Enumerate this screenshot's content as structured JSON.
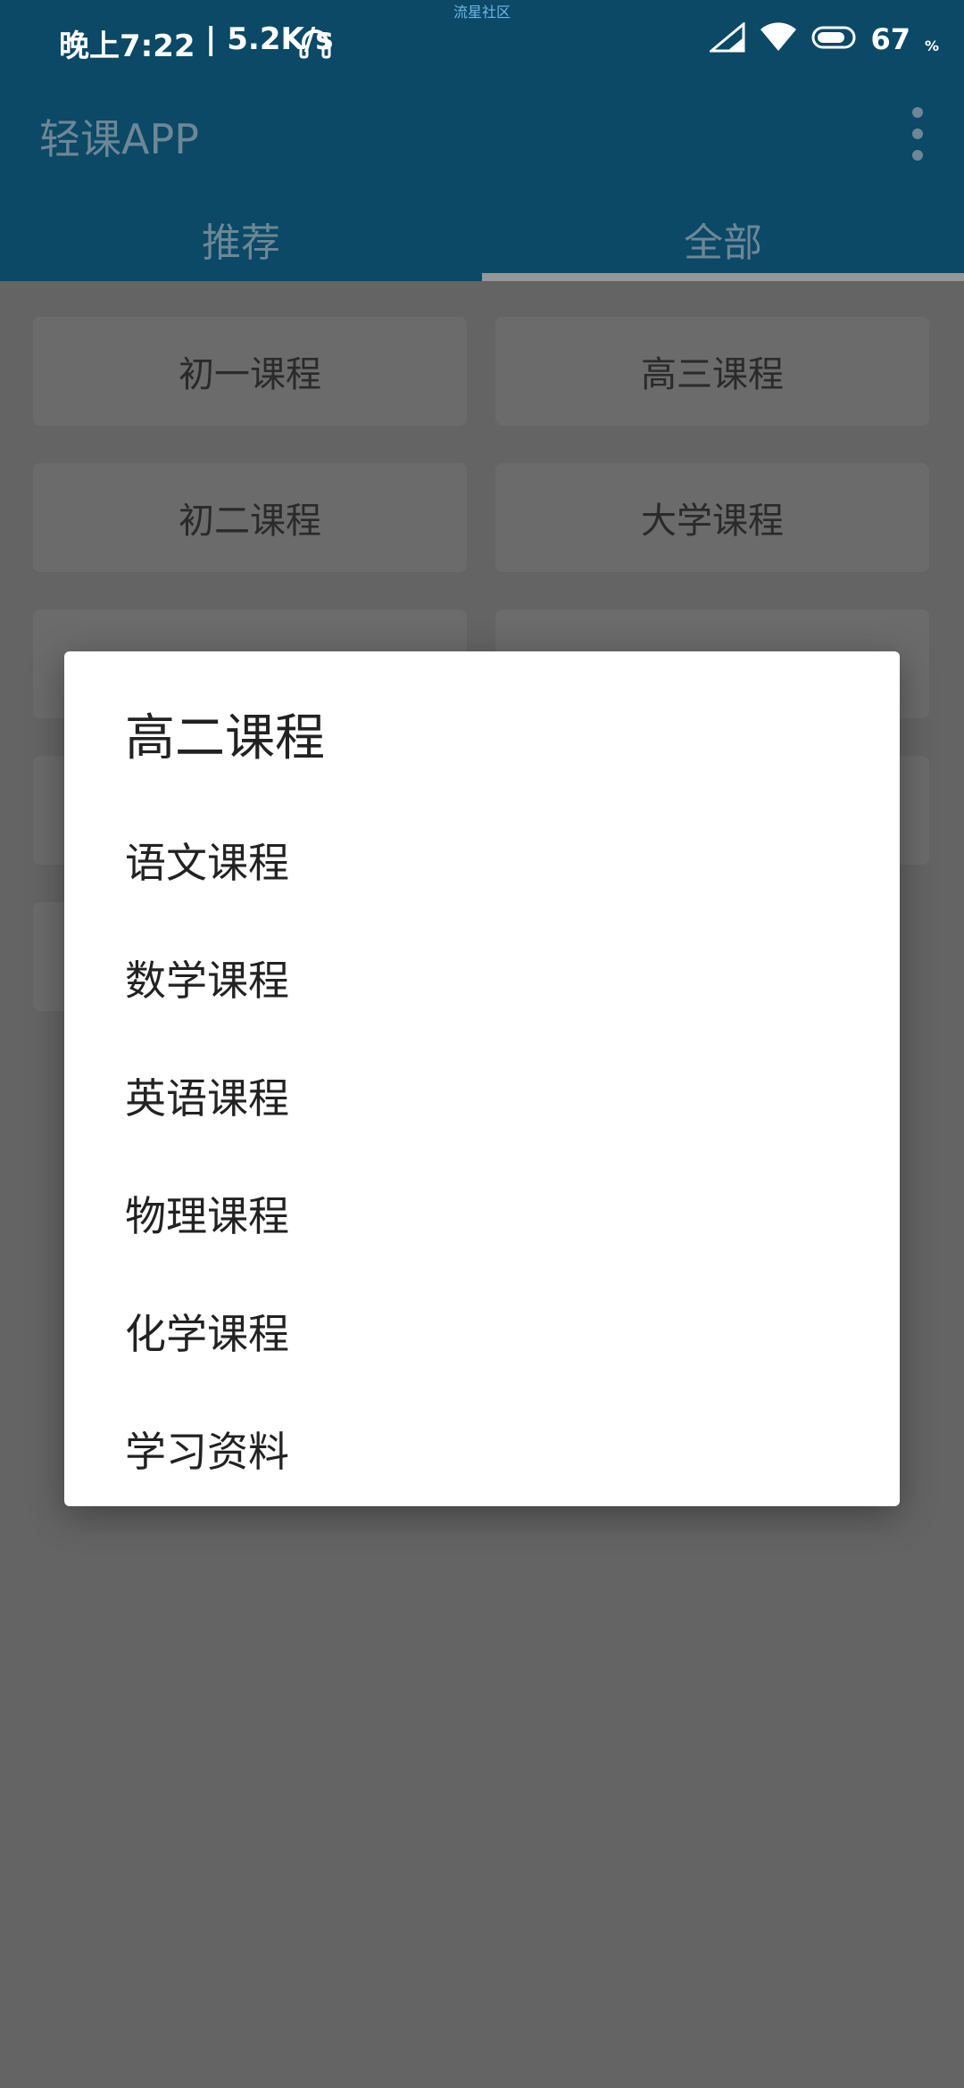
{
  "status_bar": {
    "time": "晚上7:22",
    "network": "| 5.2K/s",
    "watermark": "流星社区",
    "battery_level": "67",
    "battery_unit": "%"
  },
  "toolbar": {
    "title": "轻课APP"
  },
  "tabs": [
    {
      "label": "推荐",
      "active": false
    },
    {
      "label": "全部",
      "active": true
    }
  ],
  "courses": [
    "初一课程",
    "高三课程",
    "初二课程",
    "大学课程"
  ],
  "dialog": {
    "title": "高二课程",
    "items": [
      "语文课程",
      "数学课程",
      "英语课程",
      "物理课程",
      "化学课程",
      "学习资料"
    ]
  },
  "colors": {
    "primary_dark": "#0b4966",
    "scrim": "#646464",
    "dialog_bg": "#ffffff"
  }
}
